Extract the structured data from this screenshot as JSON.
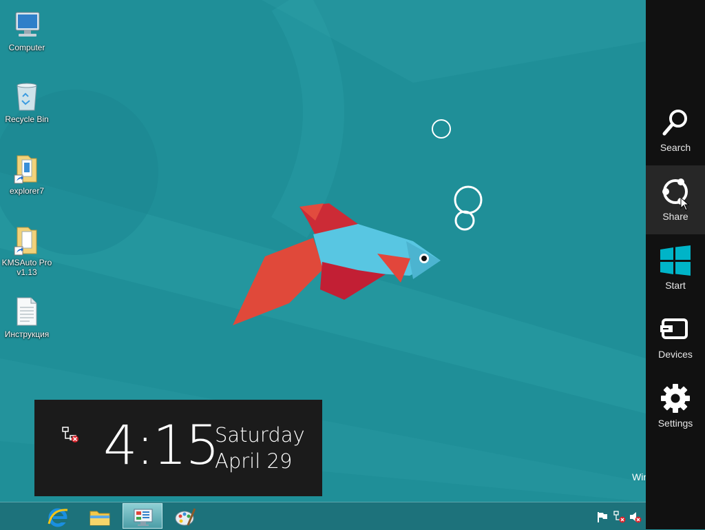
{
  "desktop": {
    "icons": [
      {
        "label": "Computer",
        "icon": "computer-icon"
      },
      {
        "label": "Recycle Bin",
        "icon": "recycle-bin-icon"
      },
      {
        "label": "explorer7",
        "icon": "folder-shortcut-icon"
      },
      {
        "label": "KMSAuto Pro\nv1.13",
        "icon": "folder-shortcut-icon"
      },
      {
        "label": "Инструкция",
        "icon": "text-document-icon"
      }
    ],
    "watermark": "Windows"
  },
  "clock": {
    "time": "4:15",
    "day": "Saturday",
    "date": "April 29",
    "network_icon": "network-disconnected-icon"
  },
  "charms": [
    {
      "label": "Search",
      "icon": "search-icon"
    },
    {
      "label": "Share",
      "icon": "share-icon"
    },
    {
      "label": "Start",
      "icon": "windows-logo-icon"
    },
    {
      "label": "Devices",
      "icon": "devices-icon"
    },
    {
      "label": "Settings",
      "icon": "gear-icon"
    }
  ],
  "taskbar": {
    "pinned": [
      "internet-explorer-icon",
      "file-explorer-icon",
      "control-panel-icon",
      "paint-icon"
    ],
    "active": "control-panel-icon",
    "tray": [
      "action-center-flag-icon",
      "network-disconnected-icon",
      "volume-muted-icon"
    ]
  },
  "colors": {
    "wallpaper": "#1f8f98",
    "charms_bg": "#111111",
    "charm_hover": "#272727",
    "clock_panel": "#1b1b1b",
    "windows_logo": "#00b4c8"
  }
}
